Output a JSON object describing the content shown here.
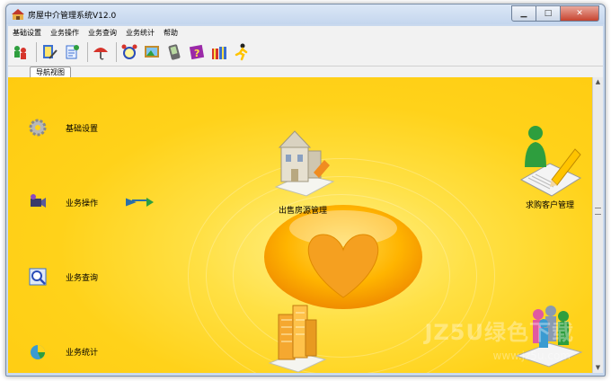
{
  "window": {
    "title": "房屋中介管理系统V12.0"
  },
  "menu": [
    "基础设置",
    "业务操作",
    "业务查询",
    "业务统计",
    "帮助"
  ],
  "toolbar_icons": [
    "person-users-icon",
    "notebook-edit-icon",
    "umbrella-icon",
    "alarm-clock-icon",
    "picture-frame-icon",
    "pda-icon",
    "help-book-icon",
    "gift-box-icon",
    "running-man-icon"
  ],
  "tab": {
    "label": "导航视图"
  },
  "nav": [
    {
      "label": "基础设置",
      "icon": "gear-icon"
    },
    {
      "label": "业务操作",
      "icon": "film-camera-icon"
    },
    {
      "label": "业务查询",
      "icon": "search-scope-icon"
    },
    {
      "label": "业务统计",
      "icon": "pie-chart-icon"
    }
  ],
  "features": {
    "sale": {
      "label": "出售房源管理",
      "icon": "house-sale-icon"
    },
    "buyer": {
      "label": "求购客户管理",
      "icon": "customer-notebook-icon"
    },
    "rent": {
      "icon": "building-rent-icon"
    },
    "customer": {
      "icon": "people-group-icon"
    }
  },
  "watermark": {
    "main": "JZ5U绿色下载",
    "sub": "www.jz5u.com"
  }
}
